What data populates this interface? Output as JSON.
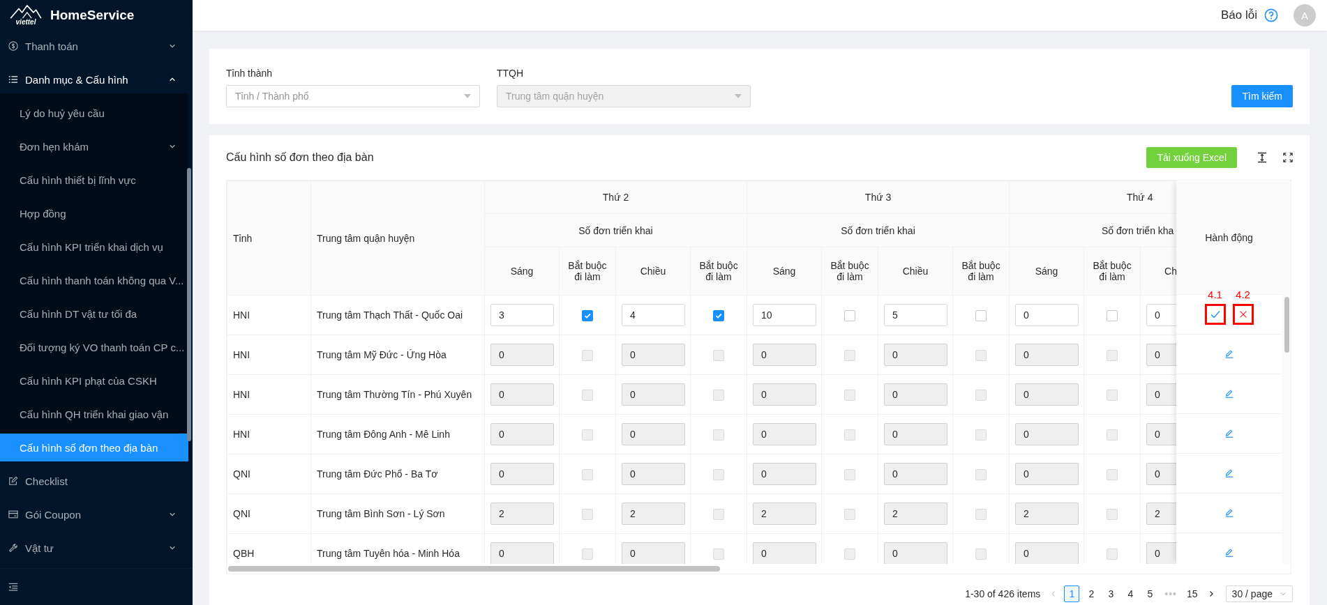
{
  "app": {
    "name": "HomeService",
    "logo_text": "viettel"
  },
  "sidebar": {
    "items": [
      {
        "label": "Thanh toán",
        "expandable": true,
        "expanded": false,
        "selected": false
      },
      {
        "label": "Danh mục & Cấu hình",
        "expandable": true,
        "expanded": true,
        "selected": false,
        "children": [
          {
            "label": "Lý do huỷ yêu cầu",
            "expandable": false,
            "selected": false
          },
          {
            "label": "Đơn hẹn khám",
            "expandable": true,
            "selected": false
          },
          {
            "label": "Cấu hình thiết bị lĩnh vực",
            "expandable": false,
            "selected": false
          },
          {
            "label": "Hợp đồng",
            "expandable": false,
            "selected": false
          },
          {
            "label": "Cấu hình KPI triển khai dịch vụ",
            "expandable": false,
            "selected": false
          },
          {
            "label": "Cấu hình thanh toán không qua V...",
            "expandable": false,
            "selected": false
          },
          {
            "label": "Cấu hình DT vật tư tối đa",
            "expandable": false,
            "selected": false
          },
          {
            "label": "Đối tượng ký VO thanh toán CP c...",
            "expandable": false,
            "selected": false
          },
          {
            "label": "Cấu hình KPI phạt của CSKH",
            "expandable": false,
            "selected": false
          },
          {
            "label": "Cấu hình QH triển khai giao vận",
            "expandable": false,
            "selected": false
          },
          {
            "label": "Cấu hình số đơn theo địa bàn",
            "expandable": false,
            "selected": true
          }
        ]
      },
      {
        "label": "Checklist",
        "expandable": false,
        "expanded": false,
        "selected": false
      },
      {
        "label": "Gói Coupon",
        "expandable": true,
        "expanded": false,
        "selected": false
      },
      {
        "label": "Vật tư",
        "expandable": true,
        "expanded": false,
        "selected": false
      }
    ]
  },
  "topbar": {
    "report_label": "Báo lỗi",
    "avatar": "A"
  },
  "filters": {
    "fields": [
      {
        "label": "Tỉnh thành",
        "placeholder": "Tỉnh / Thành phố",
        "disabled": false
      },
      {
        "label": "TTQH",
        "placeholder": "Trung tâm quận huyện",
        "disabled": true
      }
    ],
    "search_button": "Tìm kiếm"
  },
  "table_card": {
    "title": "Cấu hình số đơn theo địa bàn",
    "export_button": "Tải xuống Excel",
    "columns": {
      "province": "Tỉnh",
      "center": "Trung tâm quận huyện",
      "actions": "Hành động",
      "days": [
        {
          "label": "Thứ 2",
          "group": "Số đơn triển khai",
          "columns": [
            "Sáng",
            "Bắt buộc đi làm",
            "Chiều",
            "Bắt buộc đi làm"
          ]
        },
        {
          "label": "Thứ 3",
          "group": "Số đơn triển khai",
          "columns": [
            "Sáng",
            "Bắt buộc đi làm",
            "Chiều",
            "Bắt buộc đi làm"
          ]
        },
        {
          "label": "Thứ 4",
          "group": "Số đơn triển kha",
          "columns": [
            "Sáng",
            "Bắt buộc đi làm",
            "Ch"
          ]
        }
      ]
    },
    "rows": [
      {
        "province": "HNI",
        "center": "Trung tâm Thạch Thất - Quốc Oai",
        "editing": true,
        "cells": [
          {
            "kind": "input",
            "value": "3"
          },
          {
            "kind": "checkbox",
            "checked": true
          },
          {
            "kind": "input",
            "value": "4"
          },
          {
            "kind": "checkbox",
            "checked": true
          },
          {
            "kind": "input",
            "value": "10"
          },
          {
            "kind": "checkbox",
            "checked": false
          },
          {
            "kind": "input",
            "value": "5"
          },
          {
            "kind": "checkbox",
            "checked": false
          },
          {
            "kind": "input",
            "value": "0"
          },
          {
            "kind": "checkbox",
            "checked": false
          },
          {
            "kind": "input",
            "value": "0"
          }
        ],
        "actions": [
          {
            "kind": "save",
            "annotation": "4.1"
          },
          {
            "kind": "cancel",
            "annotation": "4.2"
          }
        ]
      },
      {
        "province": "HNI",
        "center": "Trung tâm Mỹ Đức - Ứng Hòa",
        "editing": false,
        "cells": [
          {
            "kind": "input",
            "value": "0"
          },
          {
            "kind": "checkbox",
            "checked": false
          },
          {
            "kind": "input",
            "value": "0"
          },
          {
            "kind": "checkbox",
            "checked": false
          },
          {
            "kind": "input",
            "value": "0"
          },
          {
            "kind": "checkbox",
            "checked": false
          },
          {
            "kind": "input",
            "value": "0"
          },
          {
            "kind": "checkbox",
            "checked": false
          },
          {
            "kind": "input",
            "value": "0"
          },
          {
            "kind": "checkbox",
            "checked": false
          },
          {
            "kind": "input",
            "value": "0"
          }
        ],
        "actions": [
          {
            "kind": "edit"
          }
        ]
      },
      {
        "province": "HNI",
        "center": "Trung tâm Thường Tín - Phú Xuyên",
        "editing": false,
        "cells": [
          {
            "kind": "input",
            "value": "0"
          },
          {
            "kind": "checkbox",
            "checked": false
          },
          {
            "kind": "input",
            "value": "0"
          },
          {
            "kind": "checkbox",
            "checked": false
          },
          {
            "kind": "input",
            "value": "0"
          },
          {
            "kind": "checkbox",
            "checked": false
          },
          {
            "kind": "input",
            "value": "0"
          },
          {
            "kind": "checkbox",
            "checked": false
          },
          {
            "kind": "input",
            "value": "0"
          },
          {
            "kind": "checkbox",
            "checked": false
          },
          {
            "kind": "input",
            "value": "0"
          }
        ],
        "actions": [
          {
            "kind": "edit"
          }
        ]
      },
      {
        "province": "HNI",
        "center": "Trung tâm Đông Anh - Mê Linh",
        "editing": false,
        "cells": [
          {
            "kind": "input",
            "value": "0"
          },
          {
            "kind": "checkbox",
            "checked": false
          },
          {
            "kind": "input",
            "value": "0"
          },
          {
            "kind": "checkbox",
            "checked": false
          },
          {
            "kind": "input",
            "value": "0"
          },
          {
            "kind": "checkbox",
            "checked": false
          },
          {
            "kind": "input",
            "value": "0"
          },
          {
            "kind": "checkbox",
            "checked": false
          },
          {
            "kind": "input",
            "value": "0"
          },
          {
            "kind": "checkbox",
            "checked": false
          },
          {
            "kind": "input",
            "value": "0"
          }
        ],
        "actions": [
          {
            "kind": "edit"
          }
        ]
      },
      {
        "province": "QNI",
        "center": "Trung tâm Đức Phổ - Ba Tơ",
        "editing": false,
        "cells": [
          {
            "kind": "input",
            "value": "0"
          },
          {
            "kind": "checkbox",
            "checked": false
          },
          {
            "kind": "input",
            "value": "0"
          },
          {
            "kind": "checkbox",
            "checked": false
          },
          {
            "kind": "input",
            "value": "0"
          },
          {
            "kind": "checkbox",
            "checked": false
          },
          {
            "kind": "input",
            "value": "0"
          },
          {
            "kind": "checkbox",
            "checked": false
          },
          {
            "kind": "input",
            "value": "0"
          },
          {
            "kind": "checkbox",
            "checked": false
          },
          {
            "kind": "input",
            "value": "0"
          }
        ],
        "actions": [
          {
            "kind": "edit"
          }
        ]
      },
      {
        "province": "QNI",
        "center": "Trung tâm Bình Sơn - Lý Sơn",
        "editing": false,
        "cells": [
          {
            "kind": "input",
            "value": "2"
          },
          {
            "kind": "checkbox",
            "checked": false
          },
          {
            "kind": "input",
            "value": "2"
          },
          {
            "kind": "checkbox",
            "checked": false
          },
          {
            "kind": "input",
            "value": "2"
          },
          {
            "kind": "checkbox",
            "checked": false
          },
          {
            "kind": "input",
            "value": "2"
          },
          {
            "kind": "checkbox",
            "checked": false
          },
          {
            "kind": "input",
            "value": "2"
          },
          {
            "kind": "checkbox",
            "checked": false
          },
          {
            "kind": "input",
            "value": "2"
          }
        ],
        "actions": [
          {
            "kind": "edit"
          }
        ]
      },
      {
        "province": "QBH",
        "center": "Trung tâm Tuyên hóa - Minh Hóa",
        "editing": false,
        "cells": [
          {
            "kind": "input",
            "value": "0"
          },
          {
            "kind": "checkbox",
            "checked": false
          },
          {
            "kind": "input",
            "value": "0"
          },
          {
            "kind": "checkbox",
            "checked": false
          },
          {
            "kind": "input",
            "value": "0"
          },
          {
            "kind": "checkbox",
            "checked": false
          },
          {
            "kind": "input",
            "value": "0"
          },
          {
            "kind": "checkbox",
            "checked": false
          },
          {
            "kind": "input",
            "value": "0"
          },
          {
            "kind": "checkbox",
            "checked": false
          },
          {
            "kind": "input",
            "value": "0"
          }
        ],
        "actions": [
          {
            "kind": "edit"
          }
        ]
      }
    ],
    "pagination": {
      "summary": "1-30 of 426 items",
      "prev_disabled": true,
      "next_disabled": false,
      "page_size": "30 / page",
      "pages": [
        {
          "kind": "page",
          "label": "1",
          "selected": true
        },
        {
          "kind": "page",
          "label": "2",
          "selected": false
        },
        {
          "kind": "page",
          "label": "3",
          "selected": false
        },
        {
          "kind": "page",
          "label": "4",
          "selected": false
        },
        {
          "kind": "page",
          "label": "5",
          "selected": false
        },
        {
          "kind": "ellipsis",
          "label": "•••",
          "selected": false
        },
        {
          "kind": "page",
          "label": "15",
          "selected": false
        }
      ]
    }
  }
}
